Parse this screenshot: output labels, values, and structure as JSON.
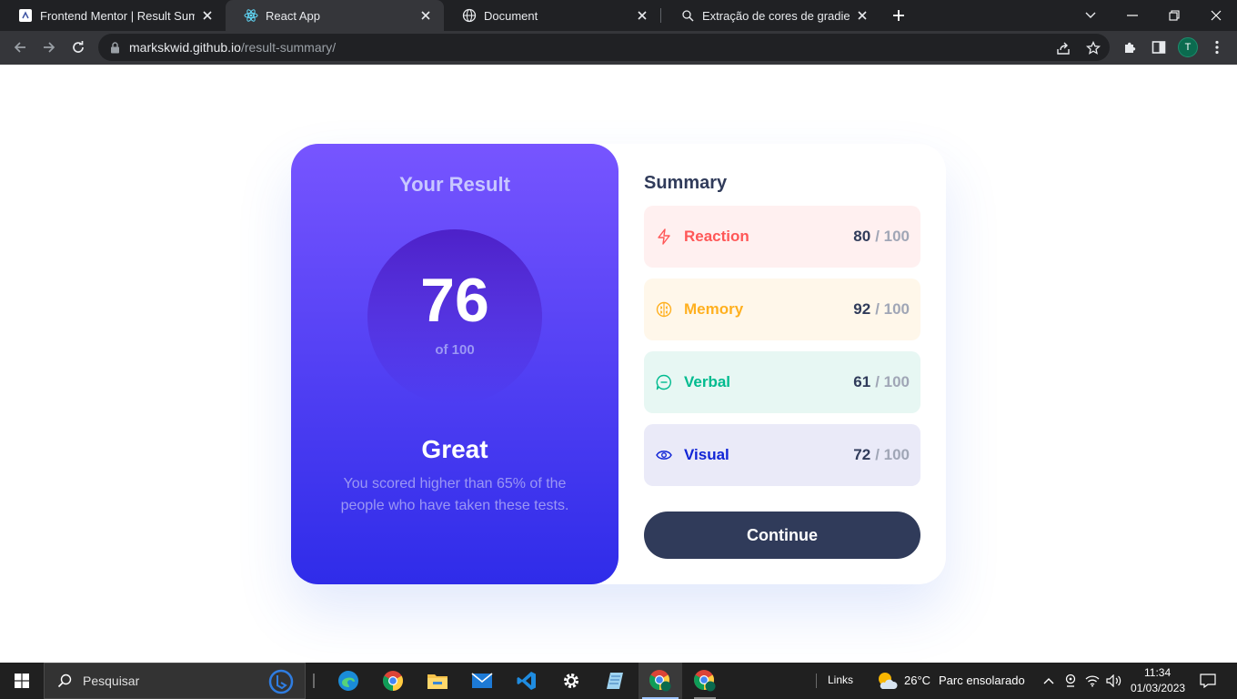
{
  "browser": {
    "tabs": [
      {
        "title": "Frontend Mentor | Result Summary",
        "favicon": "frontend-mentor-icon",
        "active": false
      },
      {
        "title": "React App",
        "favicon": "react-icon",
        "active": true
      },
      {
        "title": "Document",
        "favicon": "globe-icon",
        "active": false
      },
      {
        "title": "Extração de cores de gradiente de",
        "favicon": "extension-icon",
        "active": false
      }
    ],
    "address": {
      "domain": "markskwid.github.io",
      "path": "/result-summary/"
    },
    "profile_initial": "T"
  },
  "result": {
    "heading": "Your Result",
    "score": "76",
    "out_of": "of 100",
    "rating": "Great",
    "description": "You scored higher than 65% of the people who have taken these tests."
  },
  "summary": {
    "heading": "Summary",
    "items": [
      {
        "label": "Reaction",
        "score": "80",
        "max": "/ 100",
        "icon": "lightning-icon",
        "color": "#ff5757",
        "bg": "#fff6f5"
      },
      {
        "label": "Memory",
        "score": "92",
        "max": "/ 100",
        "icon": "brain-icon",
        "color": "#ffb01f",
        "bg": "#fffbf2"
      },
      {
        "label": "Verbal",
        "score": "61",
        "max": "/ 100",
        "icon": "chat-icon",
        "color": "#00bb8f",
        "bg": "#f2fbfa"
      },
      {
        "label": "Visual",
        "score": "72",
        "max": "/ 100",
        "icon": "eye-icon",
        "color": "#1125d6",
        "bg": "#f3f3fd"
      }
    ],
    "continue_label": "Continue"
  },
  "taskbar": {
    "search_placeholder": "Pesquisar",
    "links_label": "Links",
    "weather_temp": "26°C",
    "weather_desc": "Parc ensolarado",
    "time": "11:34",
    "date": "01/03/2023"
  }
}
